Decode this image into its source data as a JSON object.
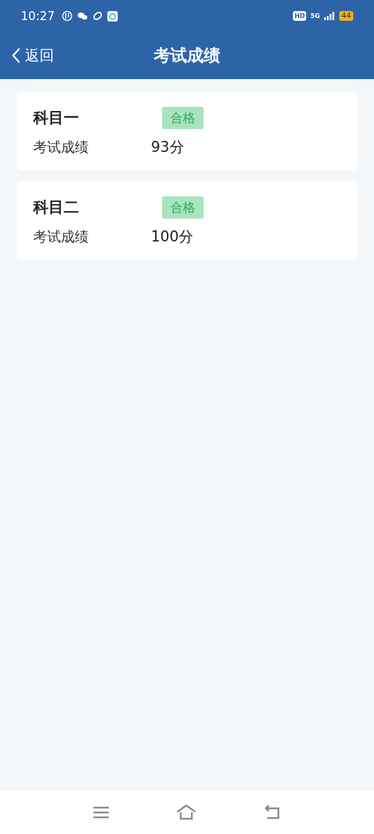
{
  "status_bar": {
    "time": "10:27",
    "hd": "HD",
    "network": "5G",
    "battery": "44"
  },
  "header": {
    "back": "返回",
    "title": "考试成绩"
  },
  "results": [
    {
      "subject": "科目一",
      "badge": "合格",
      "label": "考试成绩",
      "score": "93分"
    },
    {
      "subject": "科目二",
      "badge": "合格",
      "label": "考试成绩",
      "score": "100分"
    }
  ]
}
